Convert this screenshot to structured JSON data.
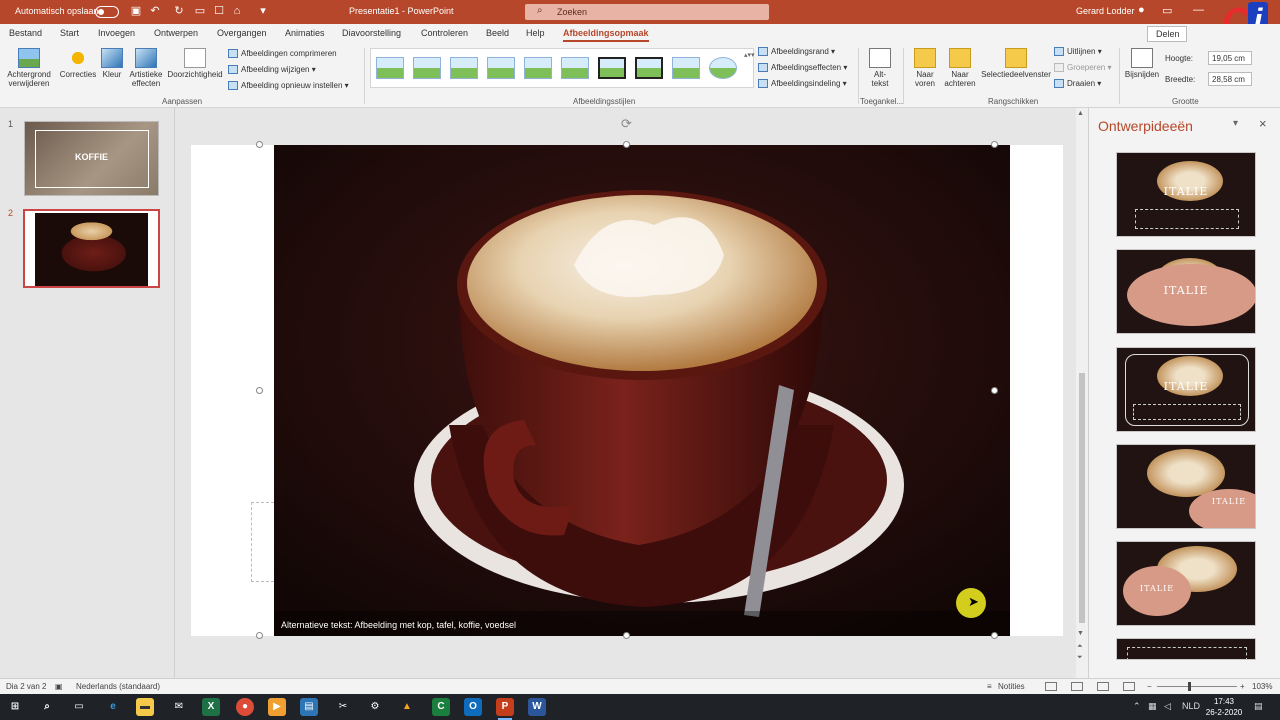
{
  "titlebar": {
    "autosave_label": "Automatisch opslaan",
    "document_title": "Presentatie1 - PowerPoint",
    "search_placeholder": "Zoeken",
    "user_name": "Gerard Lodder"
  },
  "tabs": [
    {
      "label": "Bestand"
    },
    {
      "label": "Start"
    },
    {
      "label": "Invoegen"
    },
    {
      "label": "Ontwerpen"
    },
    {
      "label": "Overgangen"
    },
    {
      "label": "Animaties"
    },
    {
      "label": "Diavoorstelling"
    },
    {
      "label": "Controleren"
    },
    {
      "label": "Beeld"
    },
    {
      "label": "Help"
    },
    {
      "label": "Afbeeldingsopmaak"
    }
  ],
  "share_label": "Delen",
  "ribbon": {
    "aanpassen": {
      "group_label": "Aanpassen",
      "background_remove": "Achtergrond verwijderen",
      "corrections": "Correcties",
      "color": "Kleur",
      "artistic": "Artistieke effecten",
      "transparency": "Doorzichtigheid",
      "compress": "Afbeeldingen comprimeren",
      "change": "Afbeelding wijzigen",
      "reset": "Afbeelding opnieuw instellen"
    },
    "styles": {
      "group_label": "Afbeeldingsstijlen",
      "border": "Afbeeldingsrand",
      "effects": "Afbeeldingseffecten",
      "layout": "Afbeeldingsindeling"
    },
    "accessibility": {
      "group_label": "Toegankel...",
      "alt_text": "Alt-tekst"
    },
    "arrange": {
      "group_label": "Rangschikken",
      "bring_forward": "Naar voren",
      "send_backward": "Naar achteren",
      "selection_pane": "Selectiedeelvenster",
      "align": "Uitlijnen",
      "group": "Groeperen",
      "rotate": "Draaien"
    },
    "size": {
      "group_label": "Grootte",
      "crop": "Bijsnijden",
      "height_label": "Hoogte:",
      "height_value": "19,05 cm",
      "width_label": "Breedte:",
      "width_value": "28,58 cm"
    }
  },
  "slides": {
    "slide1_number": "1",
    "slide1_title": "KOFFIE",
    "slide2_number": "2"
  },
  "canvas": {
    "alt_text": "Alternatieve tekst: Afbeelding met kop, tafel, koffie, voedsel"
  },
  "designer": {
    "title": "Ontwerpideeën",
    "card_title": "ITALIE"
  },
  "status": {
    "slide_indicator": "Dia 2 van 2",
    "language": "Nederlands (standaard)",
    "notes": "Notities",
    "zoom": "103%"
  },
  "taskbar": {
    "language": "NLD",
    "time": "17:43",
    "date": "26-2-2020"
  },
  "colors": {
    "accent": "#b7472a",
    "taskbar": "#1f2328"
  }
}
